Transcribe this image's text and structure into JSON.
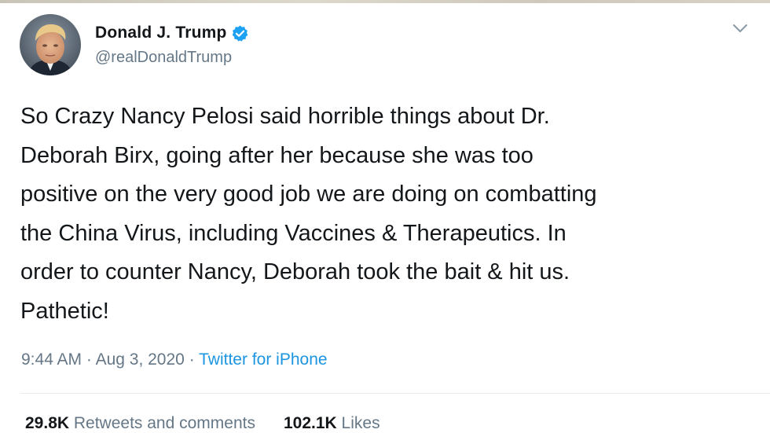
{
  "author": {
    "display_name": "Donald J. Trump",
    "handle": "@realDonaldTrump",
    "verified_icon": "verified-badge-icon"
  },
  "tweet": {
    "text_lines": [
      "So Crazy Nancy Pelosi said horrible things about Dr.",
      "Deborah Birx, going after her because she was too",
      "positive on the very good job we are doing on combatting",
      "the China Virus, including Vaccines & Therapeutics. In",
      "order to counter Nancy, Deborah took the bait & hit us.",
      "Pathetic!"
    ],
    "time": "9:44 AM",
    "separator": "·",
    "date": "Aug 3, 2020",
    "source": "Twitter for iPhone"
  },
  "stats": {
    "retweets_count": "29.8K",
    "retweets_label": "Retweets and comments",
    "likes_count": "102.1K",
    "likes_label": "Likes"
  },
  "colors": {
    "text": "#14171a",
    "secondary": "#657786",
    "accent": "#1b95e0",
    "verified": "#1da1f2"
  },
  "icons": {
    "menu": "chevron-down-icon"
  }
}
